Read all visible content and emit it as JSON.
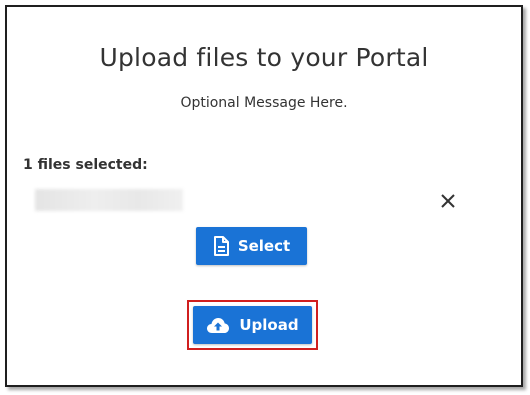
{
  "dialog": {
    "title": "Upload files to your Portal",
    "message": "Optional Message Here.",
    "files_selected_label": "1 files selected:",
    "files": [
      {
        "name": ""
      }
    ],
    "remove_icon": "close-icon",
    "select_button": {
      "label": "Select",
      "icon": "document-icon"
    },
    "upload_button": {
      "label": "Upload",
      "icon": "cloud-upload-icon"
    },
    "colors": {
      "button_primary": "#1a73d6",
      "highlight_outline": "#d01f1f",
      "text": "#333333"
    }
  }
}
